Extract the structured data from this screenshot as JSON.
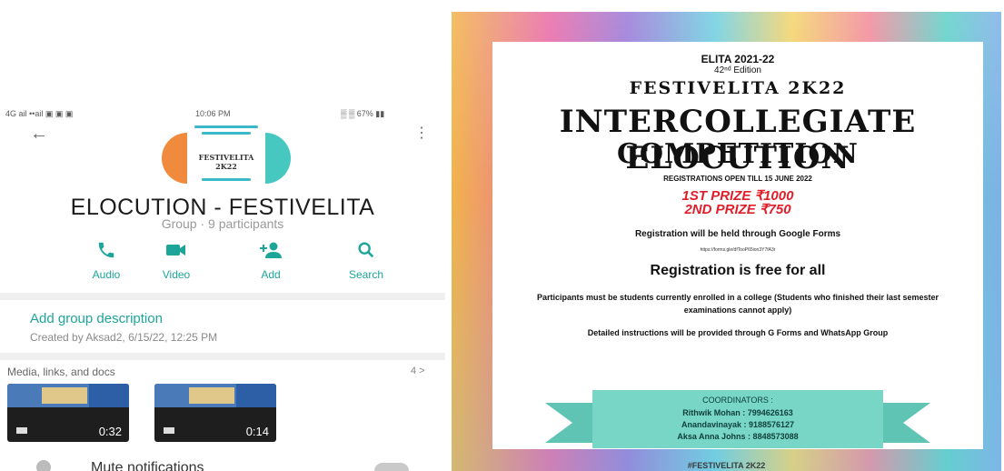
{
  "status_bar": {
    "left": "4G ail ••ail ▣ ▣ ▣",
    "time": "10:06 PM",
    "right": "▒ ▒ 67% ▮▮"
  },
  "group": {
    "avatar_text_1": "FESTIVELITA",
    "avatar_text_2": "2K22",
    "name": "ELOCUTION - FESTIVELITA",
    "subtitle": "Group · 9 participants"
  },
  "actions": [
    {
      "label": "Audio",
      "icon": "phone-icon"
    },
    {
      "label": "Video",
      "icon": "video-icon"
    },
    {
      "label": "Add",
      "icon": "add-person-icon"
    },
    {
      "label": "Search",
      "icon": "search-icon"
    }
  ],
  "description": {
    "add_label": "Add group description",
    "created": "Created by Aksad2, 6/15/22, 12:25 PM"
  },
  "media": {
    "title": "Media, links, and docs",
    "count": "4 >",
    "items": [
      {
        "duration": "0:32"
      },
      {
        "duration": "0:14"
      }
    ]
  },
  "mute_label": "Mute notifications",
  "poster": {
    "elita": "ELITA 2021-22",
    "edition": "42ⁿᵈ Edition",
    "fest": "FESTIVELITA 2K22",
    "title_1": "INTERCOLLEGIATE ELOCUTION",
    "title_2": "COMPETITION",
    "reg_open": "REGISTRATIONS OPEN TILL 15 JUNE 2022",
    "prize_1": "1ST PRIZE ₹1000",
    "prize_2": "2ND PRIZE ₹750",
    "google": "Registration will be held through Google Forms",
    "link": "https://forms.gle/dfTooP65ion3Y7fA3r",
    "free": "Registration is free for all",
    "participants": "Participants must be students currently enrolled in a college (Students who finished their last semester examinations cannot apply)",
    "detailed": "Detailed instructions will be provided through G Forms and WhatsApp Group",
    "coordinators_title": "COORDINATORS :",
    "coordinators": [
      "Rithwik Mohan : 7994626163",
      "Anandavinayak : 9188576127",
      "Aksa Anna Johns : 8848573088"
    ],
    "hashtag": "#FESTIVELITA 2K22"
  },
  "colors": {
    "accent": "#1ea59a",
    "prize": "#e01e2a",
    "ribbon": "#78d6c6"
  }
}
